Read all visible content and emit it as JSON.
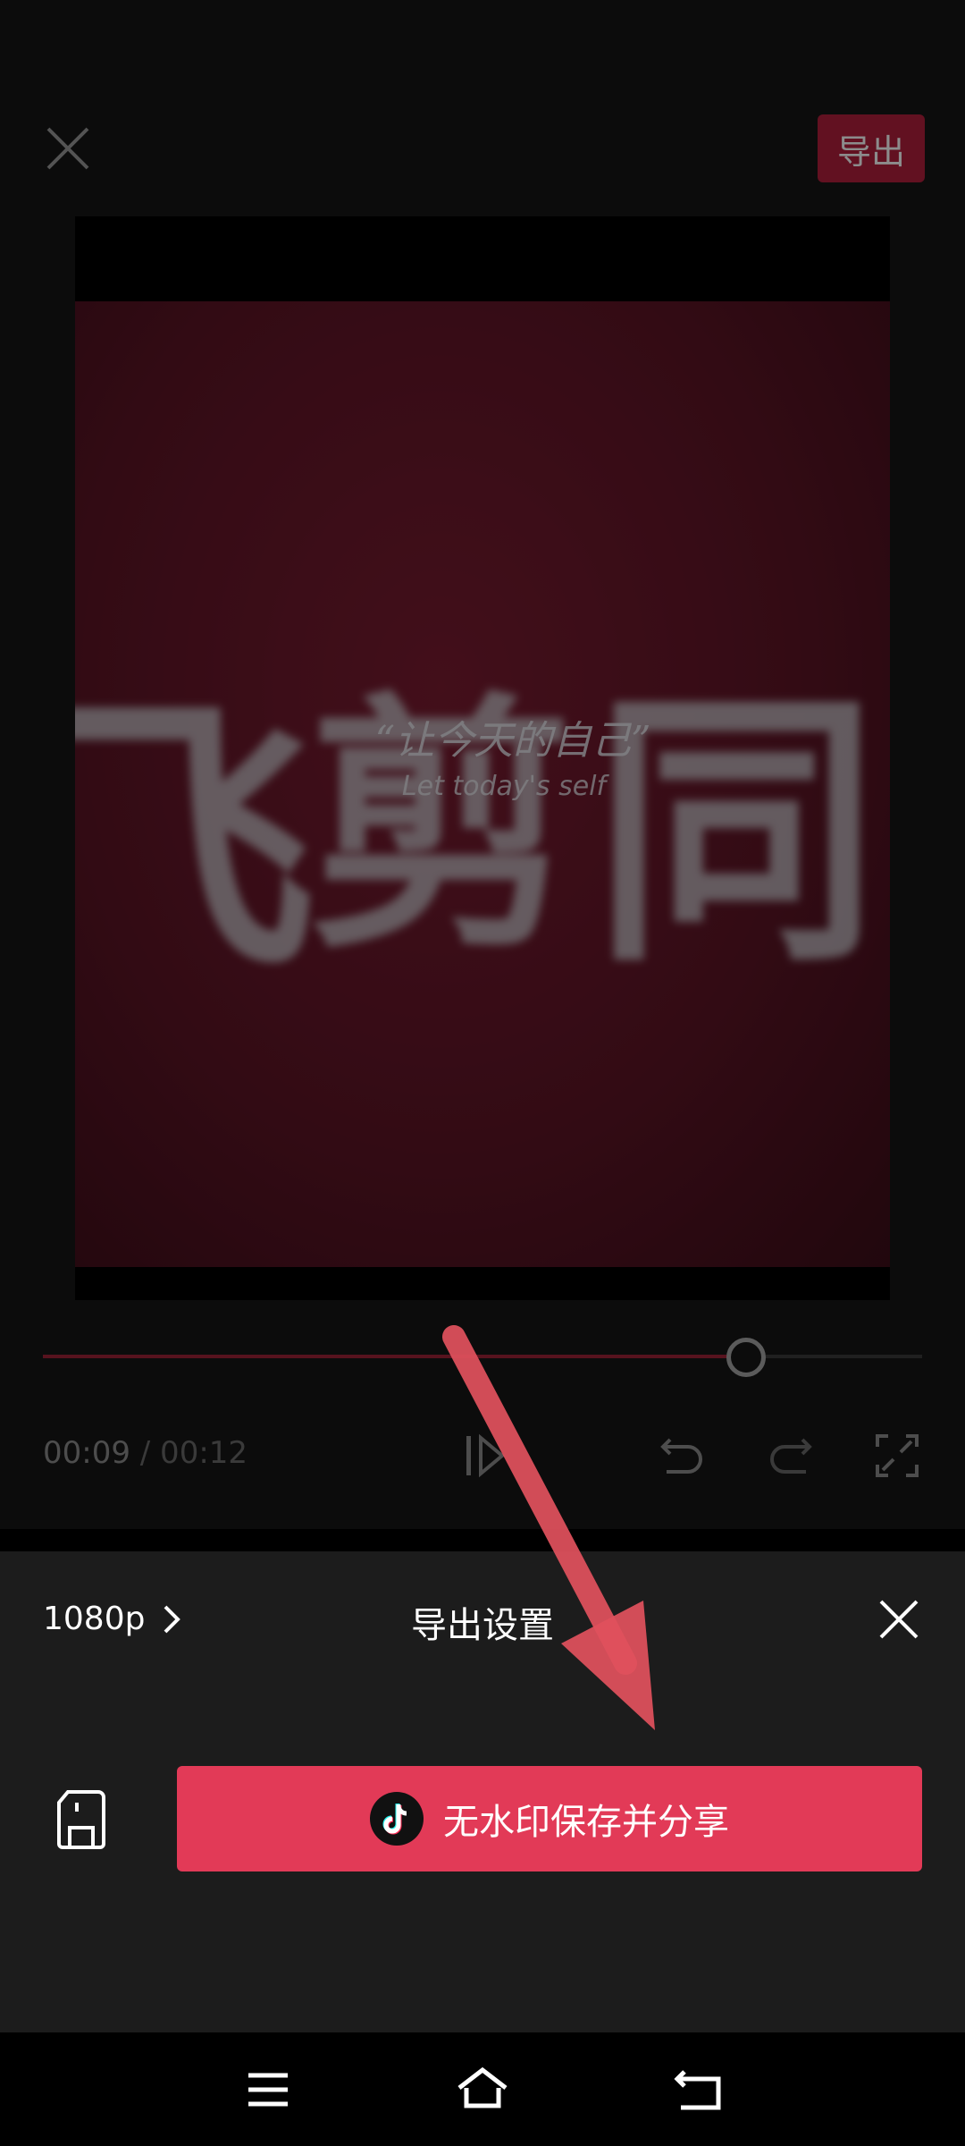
{
  "editor": {
    "export_label": "导出",
    "preview": {
      "title_chars": [
        "飞",
        "剪",
        "同"
      ],
      "quote": "“让今天的自己”",
      "subtitle": "Let today's self"
    },
    "playback": {
      "current_time": "00:09",
      "total_time": "/ 00:12",
      "progress": 0.8
    }
  },
  "sheet": {
    "quality": "1080p",
    "title": "导出设置",
    "share_button_label": "无水印保存并分享"
  },
  "icons": {
    "close": "close-icon",
    "play": "play-icon",
    "undo": "undo-icon",
    "redo": "redo-icon",
    "fullscreen": "fullscreen-icon",
    "chevron": "chevron-right-icon",
    "save": "save-icon",
    "tiktok": "tiktok-icon",
    "menu": "menu-icon",
    "home": "home-icon",
    "back": "back-icon"
  },
  "colors": {
    "accent": "#e23a57",
    "export": "#b21f3c",
    "annotation_arrow": "#e0515d"
  }
}
